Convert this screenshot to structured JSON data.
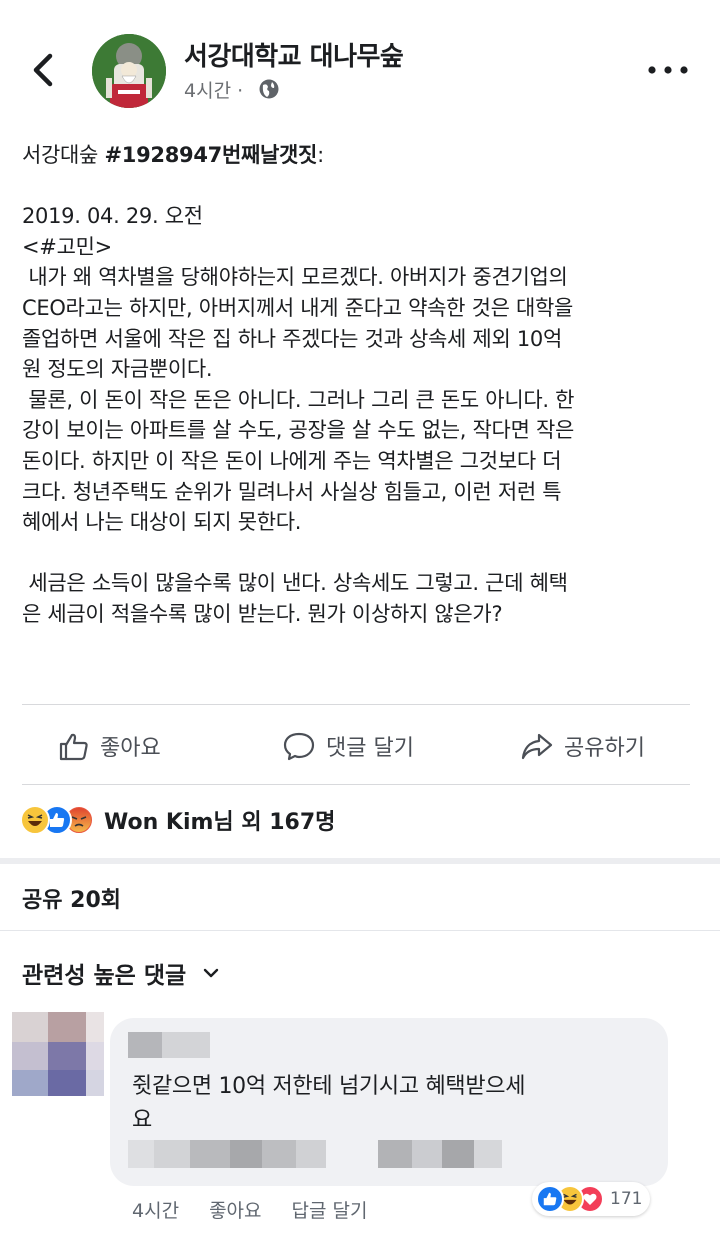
{
  "header": {
    "page_name": "서강대학교 대나무숲",
    "post_time": "4시간 ·"
  },
  "post": {
    "headline_prefix": "서강대숲 ",
    "headline_tag": "#1928947번째날갯짓",
    "headline_suffix": ":",
    "body": "\n2019. 04. 29. 오전\n<#고민>\n 내가 왜 역차별을 당해야하는지 모르겠다. 아버지가 중견기업의\nCEO라고는 하지만, 아버지께서 내게 준다고 약속한 것은 대학을\n졸업하면 서울에 작은 집 하나 주겠다는 것과 상속세 제외 10억\n원 정도의 자금뿐이다.\n 물론, 이 돈이 작은 돈은 아니다. 그러나 그리 큰 돈도 아니다. 한\n강이 보이는 아파트를 살 수도, 공장을 살 수도 없는, 작다면 작은\n돈이다. 하지만 이 작은 돈이 나에게 주는 역차별은 그것보다 더\n크다. 청년주택도 순위가 밀려나서 사실상 힘들고, 이런 저런 특\n혜에서 나는 대상이 되지 못한다.\n\n 세금은 소득이 많을수록 많이 낸다. 상속세도 그렇고. 근데 혜택\n은 세금이 적을수록 많이 받는다. 뭔가 이상하지 않은가?"
  },
  "actions": {
    "like": "좋아요",
    "comment": "댓글 달기",
    "share": "공유하기"
  },
  "reactions": {
    "summary": "Won Kim님 외 167명"
  },
  "shares": {
    "count_label": "공유 20회"
  },
  "comments": {
    "sort_label": "관련성 높은 댓글",
    "items": [
      {
        "text": "쥣같으면 10억 저한테 넘기시고 혜택받으세\n요",
        "time": "4시간",
        "like_label": "좋아요",
        "reply_label": "답글 달기",
        "reaction_count": "171"
      }
    ]
  },
  "colors": {
    "like_blue": "#1877f2",
    "haha_yellow": "#f7c53c",
    "angry_red": "#e9573f",
    "love_red": "#f33e58",
    "text_gray": "#4b4f56"
  }
}
